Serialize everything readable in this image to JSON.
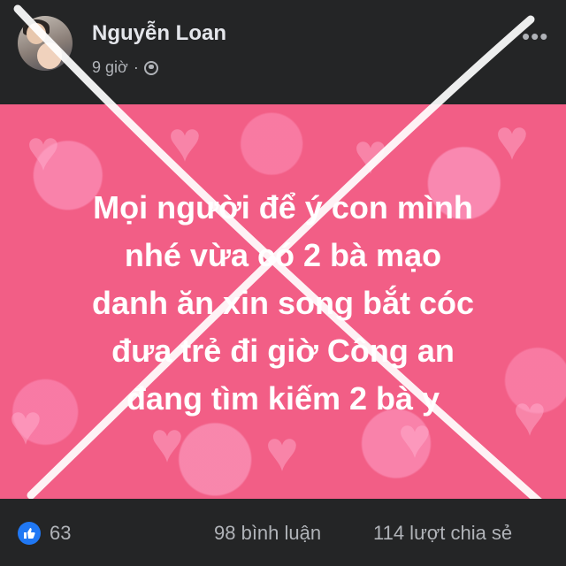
{
  "post": {
    "author": "Nguyễn Loan",
    "time": "9 giờ",
    "separator": "·",
    "privacy_icon": "globe-icon",
    "more_icon": "more-options-icon",
    "more_symbol": "•••",
    "image_text_lines": [
      "Mọi người để ý con mình",
      "nhé vừa có 2 bà  mạo",
      "danh ăn xin song bắt cóc",
      "đưa trẻ đi  giờ Công an",
      "đang tìm kiếm 2 bà y"
    ],
    "image_background_color": "#f25e86",
    "overlay_mark": "white-x-mark",
    "reactions": {
      "like_icon": "like-thumbs-up-icon",
      "count": "63"
    },
    "comments": "98 bình luận",
    "shares": "114 lượt chia sẻ"
  }
}
